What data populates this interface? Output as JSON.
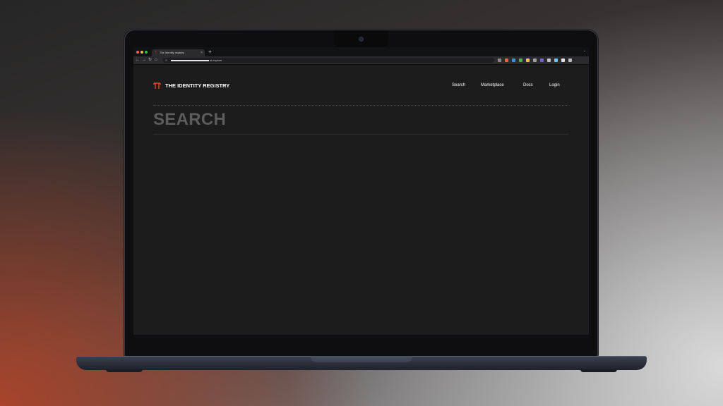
{
  "browser": {
    "tab_title": "The identity registry",
    "tab_close": "×",
    "new_tab": "+",
    "tab_menu": "⌄",
    "nav": {
      "back": "←",
      "forward": "→",
      "reload": "↻",
      "home": "⌂"
    },
    "url_suffix": "ai.explore",
    "extension_colors": [
      "#8a8a8a",
      "#e2683c",
      "#3f8fd8",
      "#4caf50",
      "#f4c542",
      "#9e9e9e",
      "#7b5cd6",
      "#c0c0c0",
      "#6ec6ff",
      "#e0e0e0",
      "#bbbbbb"
    ]
  },
  "site": {
    "title": "THE IDENTITY REGISTRY",
    "brand_color": "#e0472a",
    "nav": [
      {
        "label": "Search"
      },
      {
        "label": "Marketplace"
      },
      {
        "label": "Docs"
      },
      {
        "label": "Login"
      }
    ]
  },
  "page": {
    "heading": "SEARCH"
  }
}
